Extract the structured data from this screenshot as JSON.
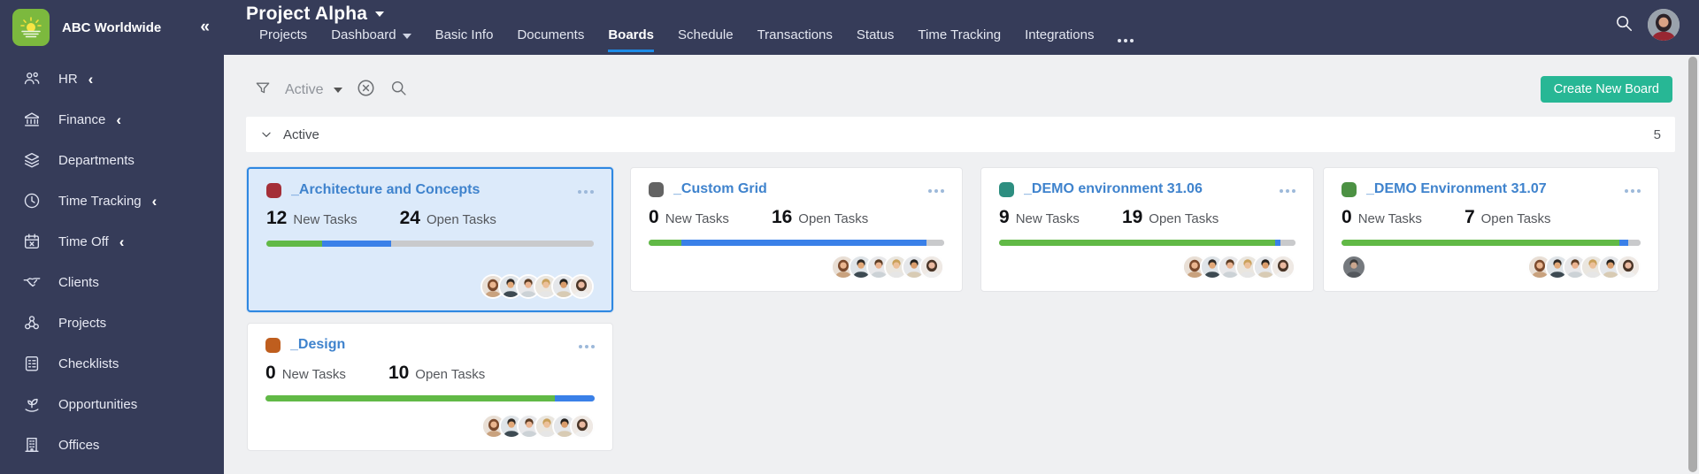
{
  "app": {
    "company": "ABC Worldwide",
    "collapse_icon": "«"
  },
  "sidebar": {
    "items": [
      {
        "label": "HR",
        "expandable": true
      },
      {
        "label": "Finance",
        "expandable": true
      },
      {
        "label": "Departments",
        "expandable": false
      },
      {
        "label": "Time Tracking",
        "expandable": true
      },
      {
        "label": "Time Off",
        "expandable": true
      },
      {
        "label": "Clients",
        "expandable": false
      },
      {
        "label": "Projects",
        "expandable": false
      },
      {
        "label": "Checklists",
        "expandable": false
      },
      {
        "label": "Opportunities",
        "expandable": false
      },
      {
        "label": "Offices",
        "expandable": false
      }
    ]
  },
  "header": {
    "title": "Project Alpha",
    "tabs": [
      {
        "label": "Projects",
        "active": false
      },
      {
        "label": "Dashboard",
        "active": false,
        "has_caret": true
      },
      {
        "label": "Basic Info",
        "active": false
      },
      {
        "label": "Documents",
        "active": false
      },
      {
        "label": "Boards",
        "active": true
      },
      {
        "label": "Schedule",
        "active": false
      },
      {
        "label": "Transactions",
        "active": false
      },
      {
        "label": "Status",
        "active": false
      },
      {
        "label": "Time Tracking",
        "active": false
      },
      {
        "label": "Integrations",
        "active": false
      }
    ]
  },
  "toolbar": {
    "filter_value": "Active",
    "create_button_label": "Create New Board"
  },
  "section": {
    "title": "Active",
    "count": "5"
  },
  "colors": {
    "accent_blue": "#1d8ce8",
    "button_green": "#27b795",
    "progress_green": "#61b946",
    "progress_blue": "#3a80e8",
    "progress_gray": "#c9cacc",
    "selected_card_bg": "#dceafa",
    "selected_card_border": "#2e87e1"
  },
  "boards": {
    "cards": [
      {
        "title": "_Architecture and Concepts",
        "dot_color": "#a42f38",
        "selected": true,
        "new_tasks": "12",
        "new_tasks_label": "New Tasks",
        "open_tasks": "24",
        "open_tasks_label": "Open Tasks",
        "progress": {
          "green_pct": 17,
          "blue_pct": 21,
          "gray_pct": 62
        },
        "avatars": 6
      },
      {
        "title": "_Custom Grid",
        "dot_color": "#636363",
        "selected": false,
        "new_tasks": "0",
        "new_tasks_label": "New Tasks",
        "open_tasks": "16",
        "open_tasks_label": "Open Tasks",
        "progress": {
          "green_pct": 11,
          "blue_pct": 83,
          "gray_pct": 6
        },
        "avatars": 6
      },
      {
        "title": "_DEMO environment 31.06",
        "dot_color": "#2d8e80",
        "selected": false,
        "new_tasks": "9",
        "new_tasks_label": "New Tasks",
        "open_tasks": "19",
        "open_tasks_label": "Open Tasks",
        "progress": {
          "green_pct": 93,
          "blue_pct": 2,
          "gray_pct": 5
        },
        "avatars": 6
      },
      {
        "title": "_DEMO Environment 31.07",
        "dot_color": "#4c9143",
        "selected": false,
        "new_tasks": "0",
        "new_tasks_label": "New Tasks",
        "open_tasks": "7",
        "open_tasks_label": "Open Tasks",
        "progress": {
          "green_pct": 93,
          "blue_pct": 3,
          "gray_pct": 4
        },
        "avatars": 6,
        "owner_avatars": 1
      },
      {
        "title": "_Design",
        "dot_color": "#bf5e1e",
        "selected": false,
        "new_tasks": "0",
        "new_tasks_label": "New Tasks",
        "open_tasks": "10",
        "open_tasks_label": "Open Tasks",
        "progress": {
          "green_pct": 88,
          "blue_pct": 12,
          "gray_pct": 0
        },
        "avatars": 6
      }
    ]
  }
}
